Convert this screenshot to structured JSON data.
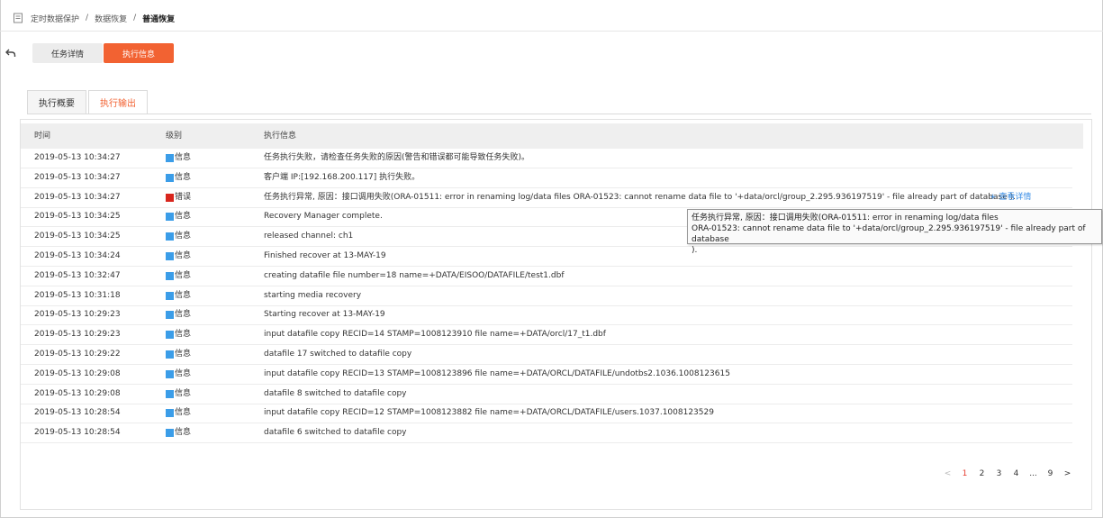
{
  "breadcrumb": {
    "items": [
      "定时数据保护",
      "数据恢复",
      "普通恢复"
    ],
    "separator": "/"
  },
  "segments": {
    "details_label": "任务详情",
    "exec_label": "执行信息"
  },
  "tabs": {
    "overview_label": "执行概要",
    "output_label": "执行输出"
  },
  "table": {
    "headers": {
      "time": "时间",
      "level": "级别",
      "message": "执行信息"
    },
    "level_colors": {
      "info": "#3b9de8",
      "error": "#d8261d"
    },
    "rows": [
      {
        "time": "2019-05-13 10:34:27",
        "level": "信息",
        "level_type": "info",
        "message": "任务执行失败，请检查任务失败的原因(警告和错误都可能导致任务失败)。"
      },
      {
        "time": "2019-05-13 10:34:27",
        "level": "信息",
        "level_type": "info",
        "message": "客户端 IP:[192.168.200.117] 执行失败。"
      },
      {
        "time": "2019-05-13 10:34:27",
        "level": "错误",
        "level_type": "error",
        "message": "任务执行异常, 原因：接口调用失败(ORA-01511: error in renaming log/data files ORA-01523: cannot rename data file to '+data/orcl/group_2.295.936197519' - file already part of database ).",
        "link": "+ 查看详情"
      },
      {
        "time": "2019-05-13 10:34:25",
        "level": "信息",
        "level_type": "info",
        "message": "Recovery Manager complete."
      },
      {
        "time": "2019-05-13 10:34:25",
        "level": "信息",
        "level_type": "info",
        "message": "released channel: ch1"
      },
      {
        "time": "2019-05-13 10:34:24",
        "level": "信息",
        "level_type": "info",
        "message": "Finished recover at 13-MAY-19"
      },
      {
        "time": "2019-05-13 10:32:47",
        "level": "信息",
        "level_type": "info",
        "message": "creating datafile file number=18 name=+DATA/EISOO/DATAFILE/test1.dbf"
      },
      {
        "time": "2019-05-13 10:31:18",
        "level": "信息",
        "level_type": "info",
        "message": "starting media recovery"
      },
      {
        "time": "2019-05-13 10:29:23",
        "level": "信息",
        "level_type": "info",
        "message": "Starting recover at 13-MAY-19"
      },
      {
        "time": "2019-05-13 10:29:23",
        "level": "信息",
        "level_type": "info",
        "message": "input datafile copy RECID=14 STAMP=1008123910 file name=+DATA/orcl/17_t1.dbf"
      },
      {
        "time": "2019-05-13 10:29:22",
        "level": "信息",
        "level_type": "info",
        "message": "datafile 17 switched to datafile copy"
      },
      {
        "time": "2019-05-13 10:29:08",
        "level": "信息",
        "level_type": "info",
        "message": "input datafile copy RECID=13 STAMP=1008123896 file name=+DATA/ORCL/DATAFILE/undotbs2.1036.1008123615"
      },
      {
        "time": "2019-05-13 10:29:08",
        "level": "信息",
        "level_type": "info",
        "message": "datafile 8 switched to datafile copy"
      },
      {
        "time": "2019-05-13 10:28:54",
        "level": "信息",
        "level_type": "info",
        "message": "input datafile copy RECID=12 STAMP=1008123882 file name=+DATA/ORCL/DATAFILE/users.1037.1008123529"
      },
      {
        "time": "2019-05-13 10:28:54",
        "level": "信息",
        "level_type": "info",
        "message": "datafile 6 switched to datafile copy"
      }
    ]
  },
  "tooltip": {
    "line1": "任务执行异常, 原因：接口调用失败(ORA-01511: error in renaming log/data files",
    "line2": "ORA-01523: cannot rename data file to '+data/orcl/group_2.295.936197519' - file already part of database",
    "line3": ")."
  },
  "pagination": {
    "prev": "<",
    "pages": [
      "1",
      "2",
      "3",
      "4",
      "...",
      "9"
    ],
    "active": "1",
    "next": ">"
  },
  "colors": {
    "accent": "#f26232",
    "link": "#3a8ee6",
    "page_active": "#e63b2e"
  }
}
